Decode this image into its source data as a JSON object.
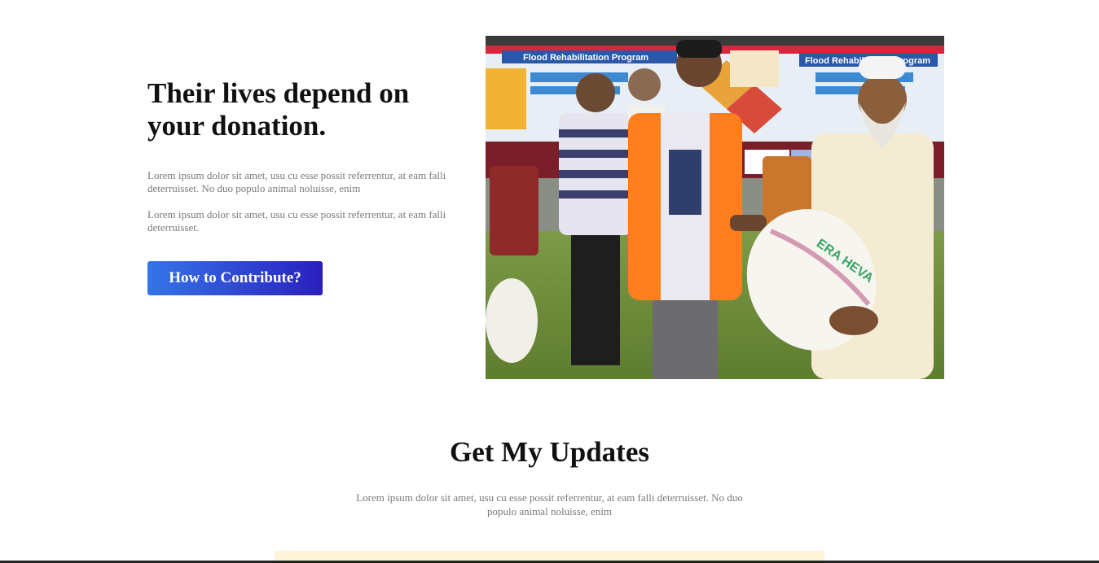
{
  "hero": {
    "title": "Their lives depend on your donation.",
    "paragraph_1": "Lorem ipsum dolor sit amet, usu cu esse possit referrentur, at eam falli deterruisset. No duo populo animal noluisse, enim",
    "paragraph_2": "Lorem ipsum dolor sit amet, usu cu esse possit referrentur, at eam falli deterruisset.",
    "cta_label": "How to Contribute?",
    "photo": {
      "banner_left": "Flood Rehabilitation Program",
      "banner_right": "Flood Rehabilitation Program",
      "sack_text": "ERA HEVA"
    }
  },
  "updates": {
    "title": "Get My Updates",
    "paragraph": "Lorem ipsum dolor sit amet, usu cu esse possit referrentur, at eam falli deterruisset. No duo populo animal noluisse, enim"
  },
  "colors": {
    "button_start": "#3575e8",
    "button_end": "#2a1fbf",
    "heading": "#111111",
    "body_text": "#7a7a7a",
    "band": "#fff3d9"
  }
}
